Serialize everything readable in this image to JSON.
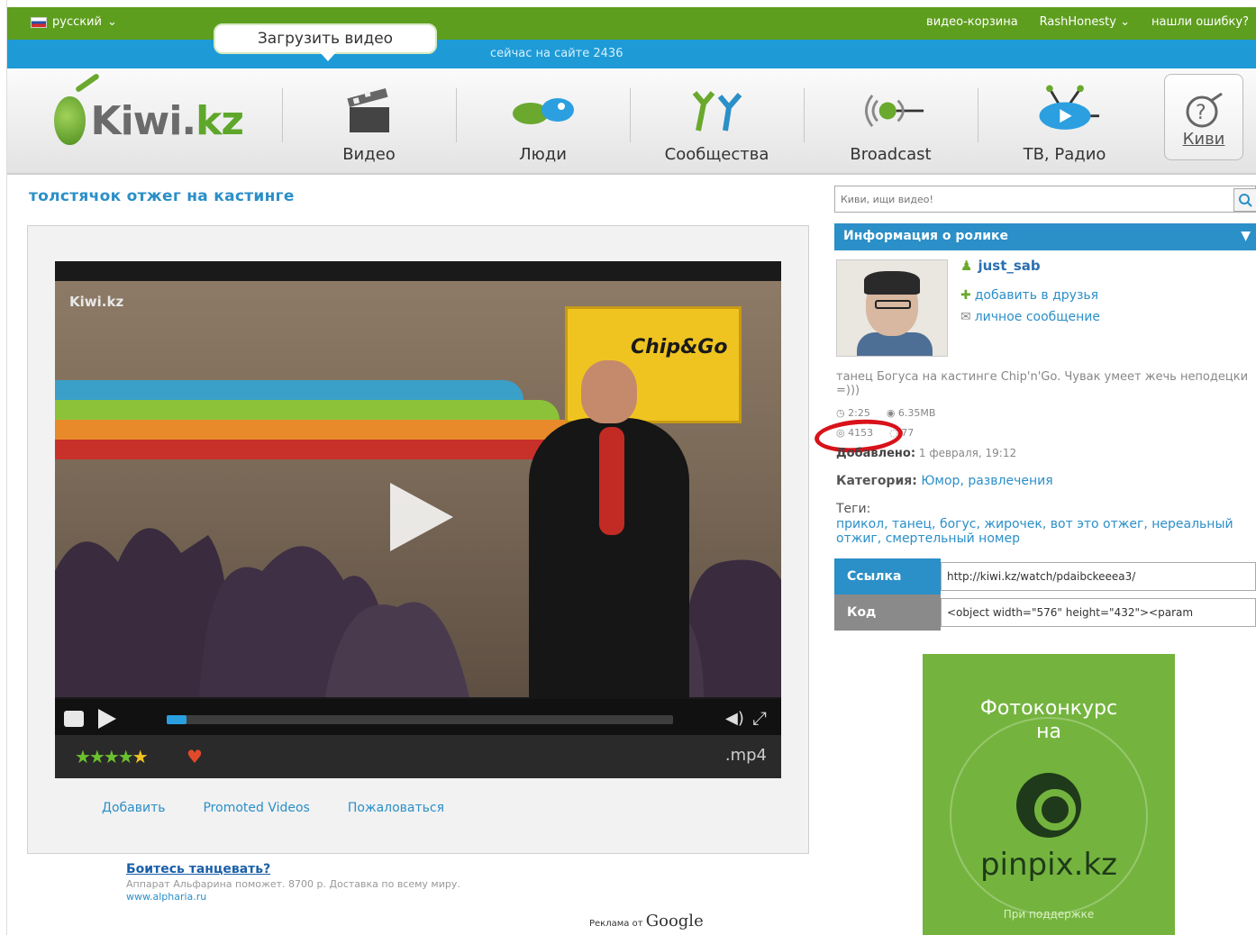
{
  "top": {
    "language": "русский",
    "links": [
      "видео-корзина",
      "RashHonesty",
      "нашли ошибку?"
    ],
    "upload_button": "Загрузить видео",
    "online": "сейчас на сайте 2436"
  },
  "logo": {
    "text_main": "Kiwi.",
    "text_accent": "kz"
  },
  "nav": [
    {
      "label": "Видео",
      "icon": "clapperboard-icon"
    },
    {
      "label": "Люди",
      "icon": "people-icon"
    },
    {
      "label": "Сообщества",
      "icon": "communities-icon"
    },
    {
      "label": "Broadcast",
      "icon": "broadcast-icon"
    },
    {
      "label": "ТВ, Радио",
      "icon": "tv-radio-icon"
    }
  ],
  "kivi_button": "Киви",
  "page_title": "толстячок отжег на кастинге",
  "player": {
    "watermark": "Kiwi.kz",
    "board_text": "Chip&Go",
    "progress": 0.04,
    "format": ".mp4",
    "rating_stars": 4.5,
    "links": [
      "Добавить",
      "Promoted Videos",
      "Пожаловаться"
    ]
  },
  "ad": {
    "title": "Боитесь танцевать?",
    "text": "Аппарат Альфарина поможет. 8700 р. Доставка по всему миру.",
    "url": "www.alpharia.ru",
    "google_label": "Реклама от",
    "google_brand": "Google"
  },
  "search": {
    "placeholder": "Киви, ищи видео!"
  },
  "info": {
    "header": "Информация о ролике",
    "username": "just_sab",
    "add_friend": "добавить в друзья",
    "message": "личное сообщение",
    "description": "танец Богуса на кастинге Chip'n'Go. Чувак умеет жечь неподецки =)))",
    "duration": "2:25",
    "size": "6.35MB",
    "views": "4153",
    "comments": "77",
    "added_label": "Добавлено:",
    "added_value": "1 февраля, 19:12",
    "category_label": "Категория:",
    "category_value": "Юмор, развлечения",
    "tags_label": "Теги:",
    "tags_value": "прикол, танец, богус, жирочек, вот это отжег, нереальный отжиг, смертельный номер",
    "link_label": "Ссылка",
    "link_value": "http://kiwi.kz/watch/pdaibckeeea3/",
    "code_label": "Код",
    "code_value": "<object width=\"576\" height=\"432\"><param"
  },
  "banner": {
    "title_line1": "Фотоконкурс",
    "title_line2": "на",
    "brand": "pinpix.kz",
    "small": "При поддержке"
  },
  "colors": {
    "green": "#5e9e1e",
    "blue": "#1e9bd6",
    "link": "#2b8fc8",
    "highlight": "#d8121a"
  }
}
